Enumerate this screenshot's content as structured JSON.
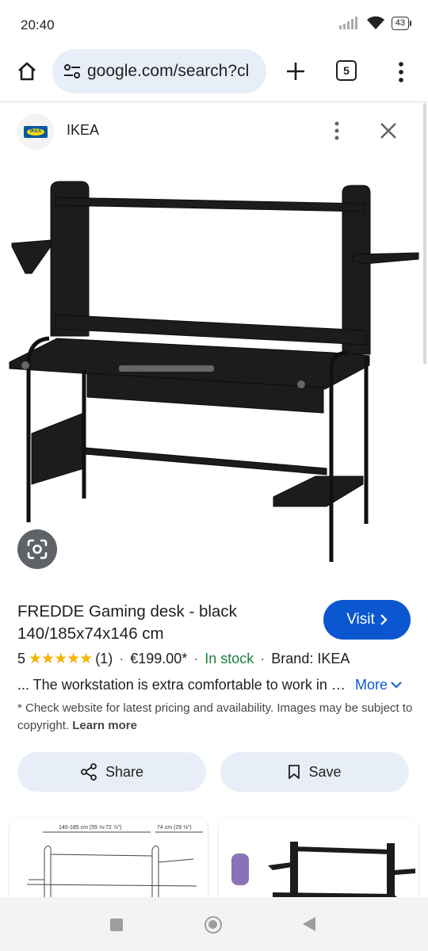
{
  "status_bar": {
    "time": "20:40",
    "battery": "43"
  },
  "browser": {
    "url": "google.com/search?cl",
    "tab_count": "5"
  },
  "sheet": {
    "source_name": "IKEA",
    "logo_text": "IKEA"
  },
  "product": {
    "title": "FREDDE Gaming desk - black 140/185x74x146 cm",
    "rating": "5",
    "stars": "★★★★★",
    "review_count": "(1)",
    "price": "€199.00*",
    "availability": "In stock",
    "brand": "Brand: IKEA",
    "snippet": "... The workstation is extra comfortable to work in as you can adjust the height",
    "more_label": "More",
    "disclaimer": "* Check website for latest pricing and availability. Images may be subject to copyright.",
    "learn_more": "Learn more",
    "visit_label": "Visit"
  },
  "actions": {
    "share_label": "Share",
    "save_label": "Save"
  },
  "related": {
    "card1_dims_top": "140-185 cm (55 ⅛-72 ⅞\")",
    "card1_dims_right": "74 cm (29 ⅛\")"
  },
  "colors": {
    "accent_blue": "#0b57d0",
    "stock_green": "#188038",
    "star_yellow": "#f4b400",
    "chip_bg": "#e8eef7"
  }
}
